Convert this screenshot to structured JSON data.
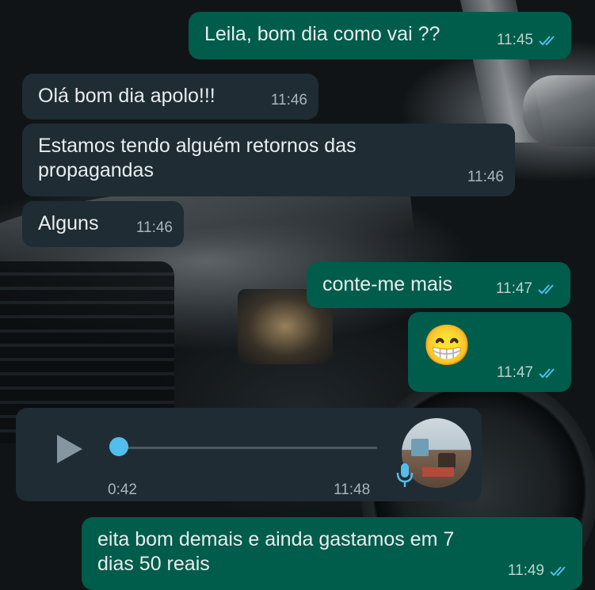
{
  "messages": [
    {
      "text": "Leila, bom dia como vai ??",
      "time": "11:45"
    },
    {
      "text": "Olá bom dia apolo!!!",
      "time": "11:46"
    },
    {
      "line1": "Estamos tendo alguém retornos das",
      "line2": "propagandas",
      "time": "11:46"
    },
    {
      "text": "Alguns",
      "time": "11:46"
    },
    {
      "text": "conte-me mais",
      "time": "11:47"
    },
    {
      "emoji": "😁",
      "time": "11:47"
    },
    {
      "line1": "eita bom demais e ainda gastamos em 7",
      "line2": "dias 50 reais",
      "time": "11:49"
    }
  ],
  "voice_note": {
    "duration": "0:42",
    "time": "11:48",
    "progress": 0.0
  },
  "colors": {
    "incoming": "#1f2c33",
    "outgoing": "#005c4b",
    "read_ticks": "#53bdeb",
    "text": "#e9edef"
  }
}
